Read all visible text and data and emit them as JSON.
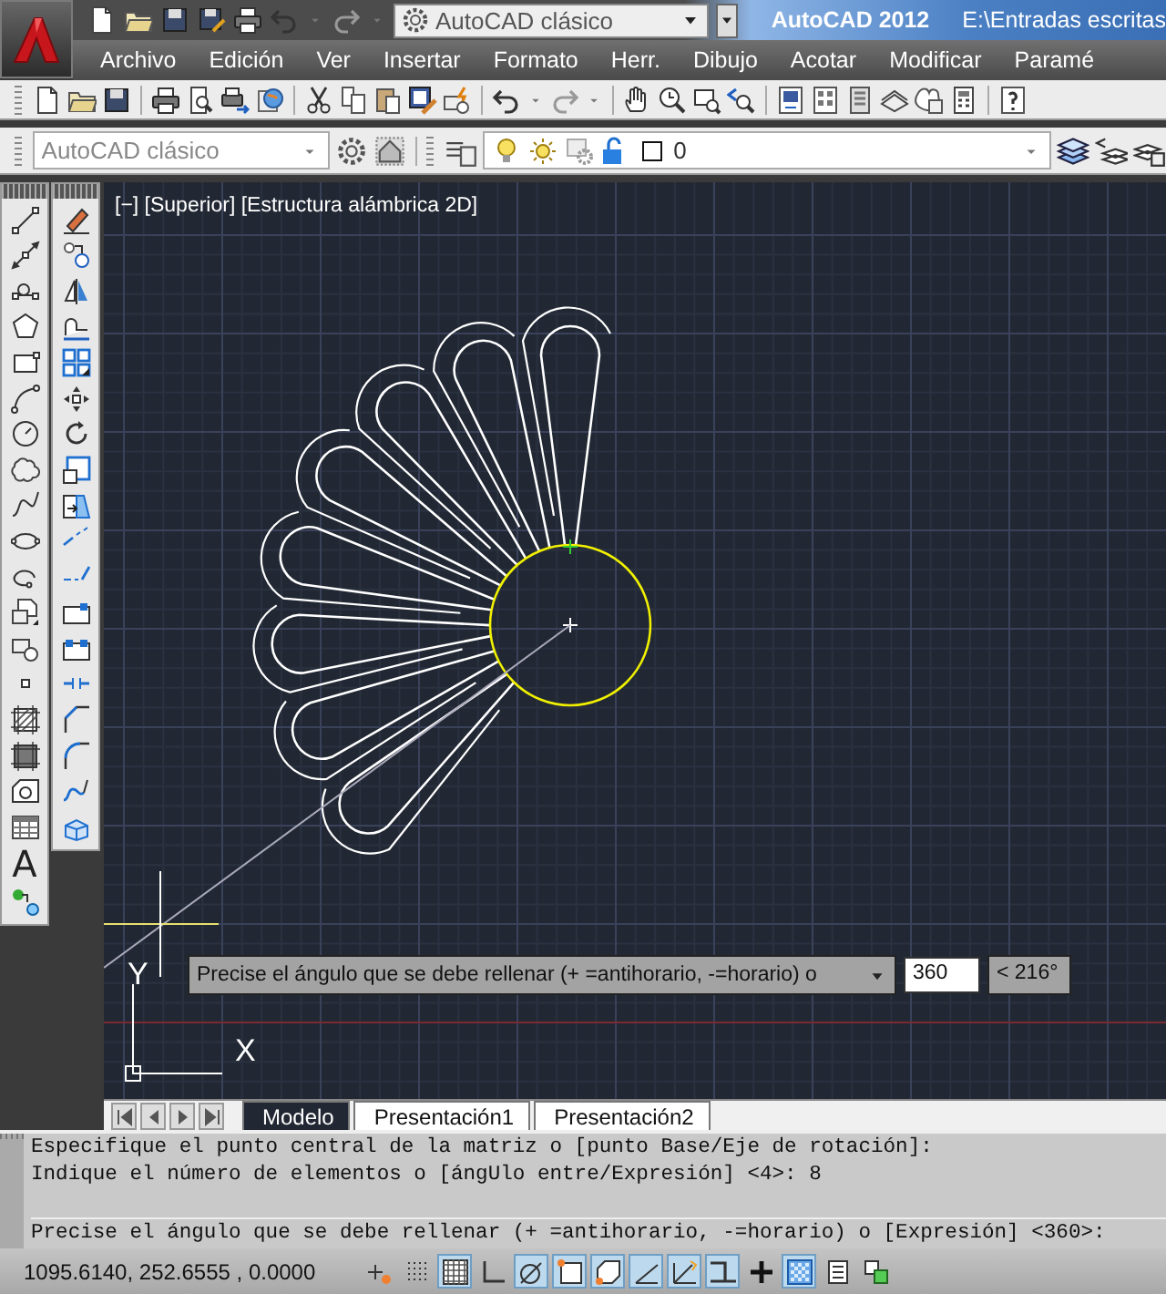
{
  "app": {
    "title": "AutoCAD 2012",
    "file": "E:\\Entradas escritas"
  },
  "quick_access": {
    "workspace": "AutoCAD clásico"
  },
  "menu": [
    "Archivo",
    "Edición",
    "Ver",
    "Insertar",
    "Formato",
    "Herr.",
    "Dibujo",
    "Acotar",
    "Modificar",
    "Paramé"
  ],
  "workspace_toolbar": {
    "workspace": "AutoCAD clásico"
  },
  "layer_toolbar": {
    "layer": "0"
  },
  "draw_toolbar": {
    "text_tool": "A"
  },
  "viewport": {
    "label": "[−] [Superior] [Estructura alámbrica 2D]",
    "ucs": {
      "x": "X",
      "y": "Y"
    }
  },
  "dynamic_input": {
    "prompt": "Precise el ángulo que se debe rellenar (+ =antihorario, -=horario) o",
    "value": "360",
    "angle": "< 216°"
  },
  "layout_tabs": [
    {
      "label": "Modelo",
      "selected": true
    },
    {
      "label": "Presentación1",
      "selected": false
    },
    {
      "label": "Presentación2",
      "selected": false
    }
  ],
  "command_history": [
    "Especifique el punto central de la matriz o [punto Base/Eje de rotación]:",
    "Indique el número de elementos o [ángUlo entre/Expresión] <4>: 8"
  ],
  "command_prompt": "Precise el ángulo que se debe rellenar (+ =antihorario, -=horario) o [Expresión] <360>:",
  "status_bar": {
    "coordinates": "1095.6140, 252.6555 , 0.0000",
    "toggles": [
      {
        "on": false
      },
      {
        "on": false
      },
      {
        "on": true
      },
      {
        "on": false
      },
      {
        "on": true
      },
      {
        "on": true
      },
      {
        "on": true
      },
      {
        "on": true
      },
      {
        "on": true
      },
      {
        "on": true
      },
      {
        "on": false
      },
      {
        "on": true
      },
      {
        "on": false
      },
      {
        "on": false
      }
    ]
  }
}
